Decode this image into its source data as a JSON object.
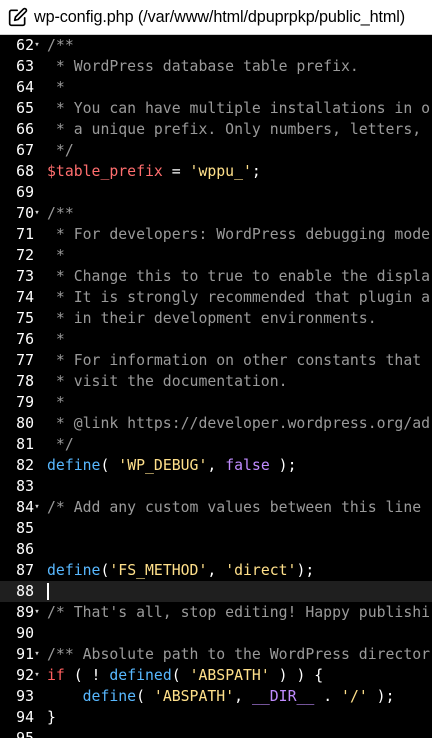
{
  "window": {
    "title": "wp-config.php (/var/www/html/dpuprpkp/public_html)",
    "icon": "edit-icon"
  },
  "editor": {
    "current_line": 88,
    "lines": [
      {
        "num": "62",
        "fold": true,
        "tokens": [
          {
            "t": "comment",
            "v": "/**"
          }
        ]
      },
      {
        "num": "63",
        "fold": false,
        "tokens": [
          {
            "t": "comment",
            "v": " * WordPress database table prefix."
          }
        ]
      },
      {
        "num": "64",
        "fold": false,
        "tokens": [
          {
            "t": "comment",
            "v": " *"
          }
        ]
      },
      {
        "num": "65",
        "fold": false,
        "tokens": [
          {
            "t": "comment",
            "v": " * You can have multiple installations in o"
          }
        ]
      },
      {
        "num": "66",
        "fold": false,
        "tokens": [
          {
            "t": "comment",
            "v": " * a unique prefix. Only numbers, letters,"
          }
        ]
      },
      {
        "num": "67",
        "fold": false,
        "tokens": [
          {
            "t": "comment",
            "v": " */"
          }
        ]
      },
      {
        "num": "68",
        "fold": false,
        "tokens": [
          {
            "t": "var",
            "v": "$table_prefix"
          },
          {
            "t": "plain",
            "v": " = "
          },
          {
            "t": "string",
            "v": "'wppu_'"
          },
          {
            "t": "plain",
            "v": ";"
          }
        ]
      },
      {
        "num": "69",
        "fold": false,
        "tokens": []
      },
      {
        "num": "70",
        "fold": true,
        "tokens": [
          {
            "t": "comment",
            "v": "/**"
          }
        ]
      },
      {
        "num": "71",
        "fold": false,
        "tokens": [
          {
            "t": "comment",
            "v": " * For developers: WordPress debugging mode"
          }
        ]
      },
      {
        "num": "72",
        "fold": false,
        "tokens": [
          {
            "t": "comment",
            "v": " *"
          }
        ]
      },
      {
        "num": "73",
        "fold": false,
        "tokens": [
          {
            "t": "comment",
            "v": " * Change this to true to enable the displa"
          }
        ]
      },
      {
        "num": "74",
        "fold": false,
        "tokens": [
          {
            "t": "comment",
            "v": " * It is strongly recommended that plugin a"
          }
        ]
      },
      {
        "num": "75",
        "fold": false,
        "tokens": [
          {
            "t": "comment",
            "v": " * in their development environments."
          }
        ]
      },
      {
        "num": "76",
        "fold": false,
        "tokens": [
          {
            "t": "comment",
            "v": " *"
          }
        ]
      },
      {
        "num": "77",
        "fold": false,
        "tokens": [
          {
            "t": "comment",
            "v": " * For information on other constants that"
          }
        ]
      },
      {
        "num": "78",
        "fold": false,
        "tokens": [
          {
            "t": "comment",
            "v": " * visit the documentation."
          }
        ]
      },
      {
        "num": "79",
        "fold": false,
        "tokens": [
          {
            "t": "comment",
            "v": " *"
          }
        ]
      },
      {
        "num": "80",
        "fold": false,
        "tokens": [
          {
            "t": "comment",
            "v": " * @link https://developer.wordpress.org/ad"
          }
        ]
      },
      {
        "num": "81",
        "fold": false,
        "tokens": [
          {
            "t": "comment",
            "v": " */"
          }
        ]
      },
      {
        "num": "82",
        "fold": false,
        "tokens": [
          {
            "t": "func",
            "v": "define"
          },
          {
            "t": "plain",
            "v": "( "
          },
          {
            "t": "string",
            "v": "'WP_DEBUG'"
          },
          {
            "t": "plain",
            "v": ", "
          },
          {
            "t": "const",
            "v": "false"
          },
          {
            "t": "plain",
            "v": " );"
          }
        ]
      },
      {
        "num": "83",
        "fold": false,
        "tokens": []
      },
      {
        "num": "84",
        "fold": true,
        "tokens": [
          {
            "t": "comment",
            "v": "/* Add any custom values between this line"
          }
        ]
      },
      {
        "num": "85",
        "fold": false,
        "tokens": []
      },
      {
        "num": "86",
        "fold": false,
        "tokens": []
      },
      {
        "num": "87",
        "fold": false,
        "tokens": [
          {
            "t": "func",
            "v": "define"
          },
          {
            "t": "plain",
            "v": "("
          },
          {
            "t": "string",
            "v": "'FS_METHOD'"
          },
          {
            "t": "plain",
            "v": ", "
          },
          {
            "t": "string",
            "v": "'direct'"
          },
          {
            "t": "plain",
            "v": ");"
          }
        ]
      },
      {
        "num": "88",
        "fold": false,
        "tokens": []
      },
      {
        "num": "89",
        "fold": true,
        "tokens": [
          {
            "t": "comment",
            "v": "/* That's all, stop editing! Happy publishi"
          }
        ]
      },
      {
        "num": "90",
        "fold": false,
        "tokens": []
      },
      {
        "num": "91",
        "fold": true,
        "tokens": [
          {
            "t": "comment",
            "v": "/** Absolute path to the WordPress director"
          }
        ]
      },
      {
        "num": "92",
        "fold": true,
        "tokens": [
          {
            "t": "keyword",
            "v": "if"
          },
          {
            "t": "plain",
            "v": " ( ! "
          },
          {
            "t": "func",
            "v": "defined"
          },
          {
            "t": "plain",
            "v": "( "
          },
          {
            "t": "string",
            "v": "'ABSPATH'"
          },
          {
            "t": "plain",
            "v": " ) ) {"
          }
        ]
      },
      {
        "num": "93",
        "fold": false,
        "tokens": [
          {
            "t": "plain",
            "v": "    "
          },
          {
            "t": "func",
            "v": "define"
          },
          {
            "t": "plain",
            "v": "( "
          },
          {
            "t": "string",
            "v": "'ABSPATH'"
          },
          {
            "t": "plain",
            "v": ", "
          },
          {
            "t": "const",
            "v": "__DIR__"
          },
          {
            "t": "plain",
            "v": " . "
          },
          {
            "t": "string",
            "v": "'/'"
          },
          {
            "t": "plain",
            "v": " );"
          }
        ]
      },
      {
        "num": "94",
        "fold": false,
        "tokens": [
          {
            "t": "plain",
            "v": "}"
          }
        ]
      },
      {
        "num": "95",
        "fold": false,
        "tokens": []
      }
    ]
  },
  "colors": {
    "background": "#000000",
    "current_line": "#1f1f1f",
    "comment": "#9a9a9a",
    "variable": "#ff6e6e",
    "string": "#ffe08a",
    "function": "#58b8ff",
    "constant": "#c08cff",
    "keyword": "#ff5f5f"
  }
}
